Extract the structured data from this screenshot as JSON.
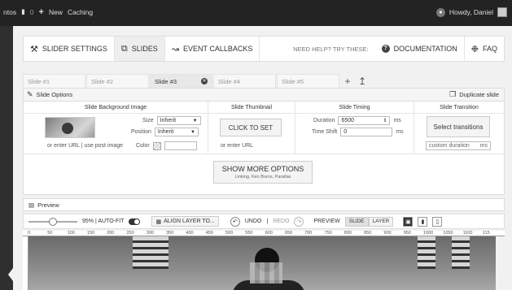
{
  "adminbar": {
    "site_fragment": "ntos",
    "comments_count": "0",
    "new_label": "New",
    "caching_label": "Caching",
    "howdy": "Howdy, Daniel"
  },
  "main_tabs": {
    "slider_settings": "SLIDER SETTINGS",
    "slides": "SLIDES",
    "event_callbacks": "EVENT CALLBACKS",
    "need_help": "NEED HELP? TRY THESE:",
    "documentation": "DOCUMENTATION",
    "faq": "FAQ"
  },
  "slide_tabs": [
    "Slide #1",
    "Slide #2",
    "Slide #3",
    "Slide #4",
    "Slide #5"
  ],
  "slide_options": {
    "title": "Slide Options",
    "duplicate": "Duplicate slide",
    "col_background": "Slide Background Image",
    "col_thumbnail": "Slide Thumbnail",
    "col_timing": "Slide Timing",
    "col_transition": "Slide Transition",
    "size_label": "Size",
    "size_value": "Inherit",
    "position_label": "Position",
    "position_value": "Inherit",
    "color_label": "Color",
    "bg_url_note": "or enter URL | use post image",
    "click_to_set": "CLICK TO SET",
    "thumb_url_note": "or enter URL",
    "duration_label": "Duration",
    "duration_value": "6500",
    "duration_unit": "ms",
    "timeshift_label": "Time Shift",
    "timeshift_value": "0",
    "timeshift_unit": "ms",
    "select_transitions": "Select transitions",
    "custom_duration": "custom duration",
    "custom_duration_unit": "ms",
    "show_more": "SHOW MORE OPTIONS",
    "show_more_sub": "Linking, Ken Burns, Parallax"
  },
  "preview": {
    "title": "Preview",
    "zoom": "95% | AUTO-FIT",
    "align": "ALIGN LAYER TO...",
    "undo": "UNDO",
    "redo": "REDO",
    "preview_label": "PREVIEW",
    "slide": "SLIDE",
    "layer": "LAYER"
  },
  "ruler_ticks": [
    "0",
    "50",
    "100",
    "150",
    "200",
    "250",
    "300",
    "350",
    "400",
    "450",
    "500",
    "550",
    "600",
    "650",
    "700",
    "750",
    "800",
    "850",
    "900",
    "950",
    "1000",
    "1050",
    "1100",
    "115"
  ]
}
